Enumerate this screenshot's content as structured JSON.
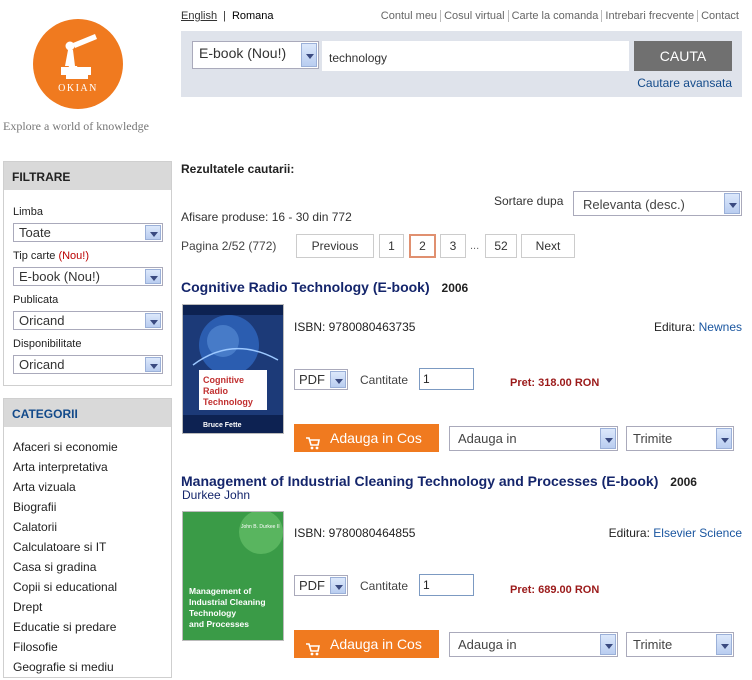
{
  "lang": {
    "english": "English",
    "romana": "Romana"
  },
  "toplinks": [
    "Contul meu",
    "Cosul virtual",
    "Carte la comanda",
    "Intrebari frecvente",
    "Contact"
  ],
  "logo": {
    "name": "OKIAN",
    "tagline": "Explore a world of knowledge"
  },
  "search": {
    "type": "E-book (Nou!)",
    "query": "technology",
    "button": "CAUTA",
    "advanced": "Cautare avansata"
  },
  "filters": {
    "title": "FILTRARE",
    "limba_label": "Limba",
    "limba_value": "Toate",
    "tip_label": "Tip carte",
    "tip_new": "(Nou!)",
    "tip_value": "E-book (Nou!)",
    "publicata_label": "Publicata",
    "publicata_value": "Oricand",
    "disponibilitate_label": "Disponibilitate",
    "disponibilitate_value": "Oricand"
  },
  "categories": {
    "title": "CATEGORII",
    "items": [
      "Afaceri si economie",
      "Arta interpretativa",
      "Arta vizuala",
      "Biografii",
      "Calatorii",
      "Calculatoare si IT",
      "Casa si gradina",
      "Copii si educational",
      "Drept",
      "Educatie si predare",
      "Filosofie",
      "Geografie si mediu"
    ]
  },
  "results": {
    "heading": "Rezultatele cautarii:",
    "sort_label": "Sortare dupa",
    "sort_value": "Relevanta (desc.)",
    "showing": "Afisare produse: 16 - 30 din 772",
    "page_info": "Pagina 2/52 (772)",
    "pagination": {
      "prev": "Previous",
      "pages": [
        "1",
        "2",
        "3"
      ],
      "dots": "...",
      "last": "52",
      "next": "Next"
    }
  },
  "products": [
    {
      "title": "Cognitive Radio Technology (E-book)",
      "year": "2006",
      "author": "",
      "isbn": "ISBN: 9780080463735",
      "editura_label": "Editura:",
      "editura": "Newnes",
      "format": "PDF",
      "qty_label": "Cantitate",
      "qty": "1",
      "price": "Pret: 318.00 RON",
      "add_cart": "Adauga in Cos",
      "add_in": "Adauga in",
      "send": "Trimite",
      "cover": {
        "line1": "Cognitive",
        "line2": "Radio",
        "line3": "Technology",
        "author": "Bruce Fette"
      }
    },
    {
      "title": "Management of Industrial Cleaning Technology and Processes (E-book)",
      "year": "2006",
      "author": "Durkee John",
      "isbn": "ISBN: 9780080464855",
      "editura_label": "Editura:",
      "editura": "Elsevier Science",
      "format": "PDF",
      "qty_label": "Cantitate",
      "qty": "1",
      "price": "Pret: 689.00 RON",
      "add_cart": "Adauga in Cos",
      "add_in": "Adauga in",
      "send": "Trimite",
      "cover": {
        "author": "John B. Durkee II",
        "line1": "Management of",
        "line2": "Industrial Cleaning",
        "line3": "Technology",
        "line4": "and Processes"
      }
    }
  ],
  "colors": {
    "accent": "#f07a1f",
    "title": "#14256b",
    "price": "#9b1a1a"
  }
}
